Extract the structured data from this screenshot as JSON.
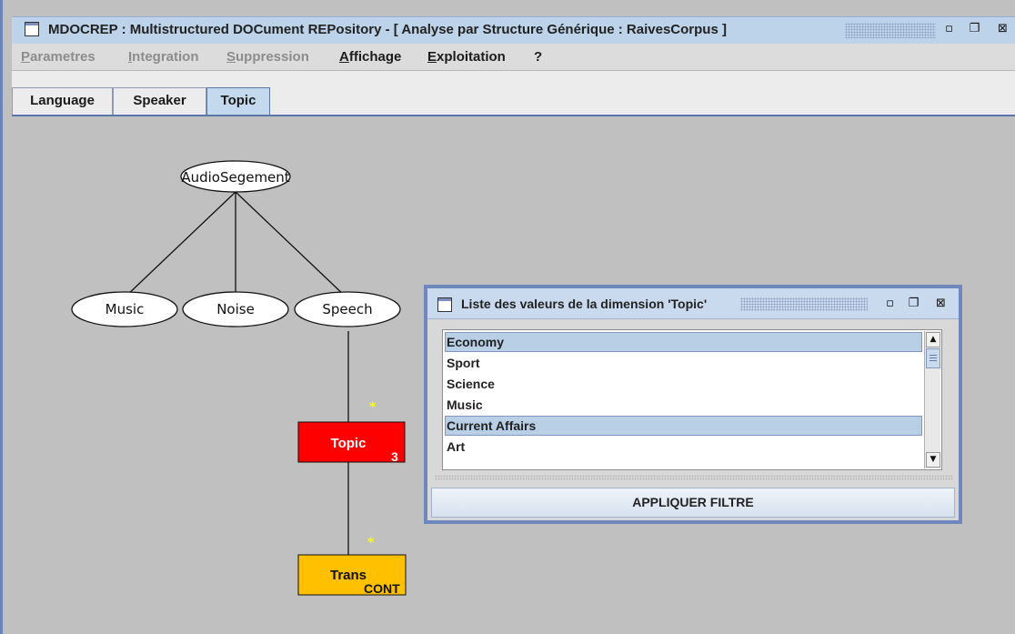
{
  "window": {
    "title": "MDOCREP : Multistructured DOCument REPository - [ Analyse par Structure Générique : RaivesCorpus  ]",
    "buttons": {
      "iconify": "▫",
      "maximize": "❐",
      "close": "⊠"
    }
  },
  "menubar": {
    "items": [
      {
        "label": "Parametres",
        "mnemonic": "P",
        "rest": "arametres",
        "enabled": false
      },
      {
        "label": "Integration",
        "mnemonic": "I",
        "rest": "ntegration",
        "enabled": false
      },
      {
        "label": "Suppression",
        "mnemonic": "S",
        "rest": "uppression",
        "enabled": false
      },
      {
        "label": "Affichage",
        "mnemonic": "A",
        "rest": "ffichage",
        "enabled": true
      },
      {
        "label": "Exploitation",
        "mnemonic": "E",
        "rest": "xploitation",
        "enabled": true
      },
      {
        "label": "?",
        "mnemonic": "",
        "rest": "?",
        "enabled": true
      }
    ]
  },
  "tabs": [
    {
      "label": "Language",
      "active": false
    },
    {
      "label": "Speaker",
      "active": false
    },
    {
      "label": "Topic",
      "active": true
    }
  ],
  "tree": {
    "root": "AudioSegement",
    "children": [
      "Music",
      "Noise",
      "Speech"
    ],
    "topic_node": {
      "label": "Topic",
      "count": "3",
      "color": "#ff0000",
      "multiplicity": "*"
    },
    "trans_node": {
      "label": "Trans",
      "sublabel": "CONT",
      "color": "#ffc000",
      "multiplicity": "*"
    }
  },
  "values_dialog": {
    "title": "Liste des valeurs de la dimension 'Topic'",
    "items": [
      {
        "label": "Economy",
        "selected": true
      },
      {
        "label": "Sport",
        "selected": false
      },
      {
        "label": "Science",
        "selected": false
      },
      {
        "label": "Music",
        "selected": false
      },
      {
        "label": "Current Affairs",
        "selected": true
      },
      {
        "label": "Art",
        "selected": false
      }
    ],
    "scroll_up": "▲",
    "scroll_down": "▼",
    "apply_label": "APPLIQUER FILTRE"
  },
  "colors": {
    "title_bar": "#bdd3ea",
    "active_tab": "#c4d8ee",
    "selection": "#b8cfe6",
    "workspace": "#c0c0c0"
  }
}
